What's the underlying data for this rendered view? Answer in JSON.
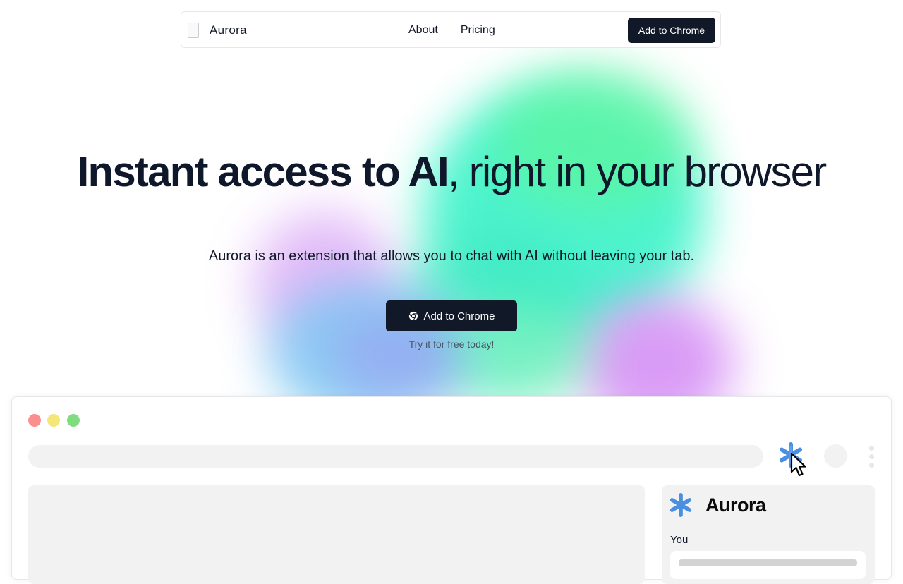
{
  "nav": {
    "brand": "Aurora",
    "links": [
      "About",
      "Pricing"
    ],
    "cta_label": "Add to Chrome"
  },
  "hero": {
    "title_bold": "Instant access to AI",
    "title_rest": ", right in your browser",
    "subtitle": "Aurora is an extension that allows you to chat with AI without leaving your tab.",
    "button_label": "Add to Chrome",
    "note": "Try it for free today!"
  },
  "mockup": {
    "panel_title": "Aurora",
    "panel_sender": "You"
  },
  "colors": {
    "primary_dark": "#111827",
    "extension_blue": "#4a8fe0",
    "window_red": "#fb8f8f",
    "window_yellow": "#f5e67a",
    "window_green": "#7fdd7f"
  },
  "icons": [
    "broken-logo-image",
    "chrome-icon",
    "aurora-asterisk-icon",
    "mouse-cursor-icon",
    "kebab-menu-icon"
  ]
}
